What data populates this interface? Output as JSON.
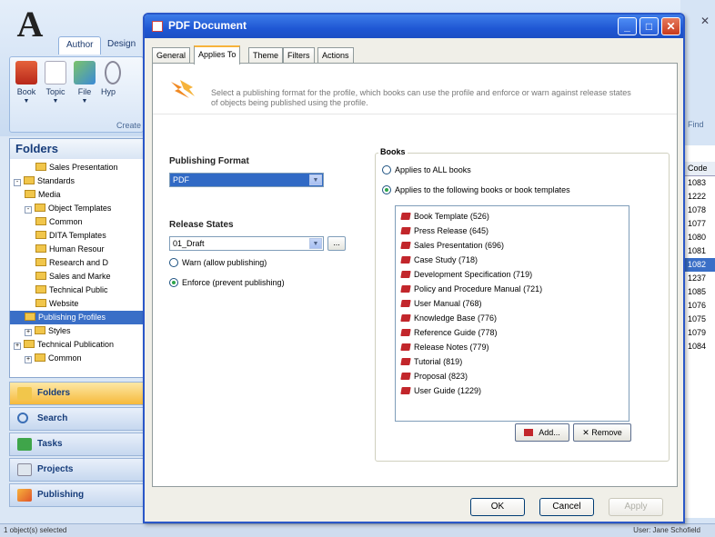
{
  "app": {
    "ribbon_tabs": [
      "Author",
      "Design"
    ],
    "create_buttons": [
      "Book",
      "Topic",
      "File",
      "Hyp"
    ],
    "create_group_label": "Create",
    "find_label": "Find",
    "folders_title": "Folders",
    "tree": [
      {
        "label": "Sales Presentation",
        "level": 3,
        "pm": ""
      },
      {
        "label": "Standards",
        "level": 1,
        "pm": "-"
      },
      {
        "label": "Media",
        "level": 2,
        "pm": ""
      },
      {
        "label": "Object Templates",
        "level": 2,
        "pm": "-"
      },
      {
        "label": "Common",
        "level": 3,
        "pm": ""
      },
      {
        "label": "DITA Templates",
        "level": 3,
        "pm": ""
      },
      {
        "label": "Human Resour",
        "level": 3,
        "pm": ""
      },
      {
        "label": "Research and D",
        "level": 3,
        "pm": ""
      },
      {
        "label": "Sales and Marke",
        "level": 3,
        "pm": ""
      },
      {
        "label": "Technical Public",
        "level": 3,
        "pm": ""
      },
      {
        "label": "Website",
        "level": 3,
        "pm": ""
      },
      {
        "label": "Publishing Profiles",
        "level": 2,
        "pm": "",
        "selected": true
      },
      {
        "label": "Styles",
        "level": 2,
        "pm": "+"
      },
      {
        "label": "Technical Publication",
        "level": 1,
        "pm": "+"
      },
      {
        "label": "Common",
        "level": 2,
        "pm": "+"
      }
    ],
    "nav_buttons": [
      "Folders",
      "Search",
      "Tasks",
      "Projects",
      "Publishing"
    ],
    "codes_header": "Code",
    "codes": [
      "1083",
      "1222",
      "1078",
      "1077",
      "1080",
      "1081",
      "1082",
      "1237",
      "1085",
      "1076",
      "1075",
      "1079",
      "1084"
    ],
    "selected_code": "1082",
    "status_left": "1 object(s) selected",
    "status_user": "User: Jane Schofield"
  },
  "dialog": {
    "title": "PDF Document",
    "tabs": [
      "General",
      "Applies To",
      "Theme",
      "Filters",
      "Actions"
    ],
    "active_tab": "Applies To",
    "info_text": "Select a publishing format for the profile, which books can use the profile and enforce or warn against release states of objects being published using the profile.",
    "publishing_format_label": "Publishing Format",
    "publishing_format_value": "PDF",
    "release_states_label": "Release States",
    "release_states_value": "01_Draft",
    "ellipsis_label": "...",
    "warn_label": "Warn (allow publishing)",
    "enforce_label": "Enforce (prevent publishing)",
    "enforce_selected": true,
    "books_label": "Books",
    "applies_all_label": "Applies to ALL books",
    "applies_following_label": "Applies to the following books or book templates",
    "applies_following_selected": true,
    "books": [
      "Book Template (526)",
      "Press Release (645)",
      "Sales Presentation (696)",
      "Case Study (718)",
      "Development Specification (719)",
      "Policy and Procedure Manual (721)",
      "User Manual (768)",
      "Knowledge Base (776)",
      "Reference Guide (778)",
      "Release Notes (779)",
      "Tutorial (819)",
      "Proposal (823)",
      "User Guide (1229)"
    ],
    "add_label": "Add...",
    "remove_label": "Remove",
    "ok_label": "OK",
    "cancel_label": "Cancel",
    "apply_label": "Apply"
  },
  "colors": {
    "titlebar": "#1f57d4",
    "selection": "#316ac5",
    "book_icon": "#c2262b",
    "tab_highlight": "#f7b33b"
  }
}
